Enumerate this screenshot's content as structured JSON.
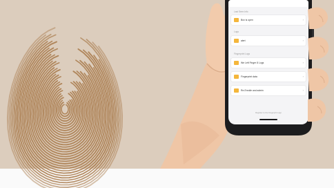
{
  "colors": {
    "background_beige": "#dccdbd",
    "floor_white": "#fafafa",
    "fingerprint_ink": "#a8794a",
    "skin": "#efc6a6",
    "skin_shadow": "#dcae8c",
    "phone_frame": "#1c1c1e",
    "screen_bg": "#f4f4f6",
    "card_bg": "#ffffff",
    "accent_yellow": "#f4b63b",
    "text_dark": "#333333",
    "text_muted": "#9a9a9a"
  },
  "screen": {
    "sections": [
      {
        "title": "Last Seen Info",
        "cards": [
          {
            "label": "Box is open"
          }
        ]
      },
      {
        "title": "Logs",
        "cards": [
          {
            "label": "alert"
          }
        ]
      },
      {
        "title": "Fingerprint Logs",
        "cards": [
          {
            "label": "We Left Finger 8 Logs"
          },
          {
            "label": "Fingerprint data"
          },
          {
            "label": "Re-Enrolle and admin"
          }
        ]
      }
    ],
    "footer": "Register to the Fingerprint app"
  },
  "icons": {
    "card_icon": "folder-icon",
    "chevron": "chevron-right-icon"
  }
}
